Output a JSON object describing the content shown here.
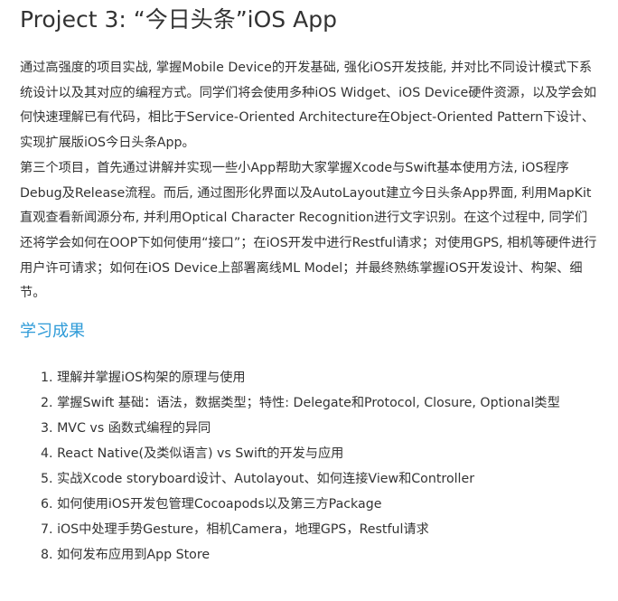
{
  "project": {
    "title": "Project 3: “今日头条”iOS App"
  },
  "description": {
    "paragraphs": [
      "通过高强度的项目实战, 掌握Mobile Device的开发基础, 强化iOS开发技能, 并对比不同设计模式下系统设计以及其对应的编程方式。同学们将会使用多种iOS Widget、iOS Device硬件资源，以及学会如何快速理解已有代码，相比于Service-Oriented Architecture在Object-Oriented Pattern下设计、实现扩展版iOS今日头条App。",
      "第三个项目，首先通过讲解并实现一些小App帮助大家掌握Xcode与Swift基本使用方法, iOS程序Debug及Release流程。而后, 通过图形化界面以及AutoLayout建立今日头条App界面, 利用MapKit直观查看新闻源分布, 并利用Optical Character Recognition进行文字识别。在这个过程中, 同学们还将学会如何在OOP下如何使用“接口”；在iOS开发中进行Restful请求；对使用GPS, 相机等硬件进行用户许可请求；如何在iOS Device上部署离线ML Model；并最终熟练掌握iOS开发设计、构架、细节。"
    ]
  },
  "outcomes": {
    "heading": "学习成果",
    "items": [
      {
        "number": "1.",
        "text": "理解并掌握iOS构架的原理与使用"
      },
      {
        "number": "2.",
        "text": "掌握Swift 基础：语法，数据类型；特性: Delegate和Protocol, Closure, Optional类型"
      },
      {
        "number": "3.",
        "text": "MVC vs 函数式编程的异同"
      },
      {
        "number": "4.",
        "text": "React Native(及类似语言) vs Swift的开发与应用"
      },
      {
        "number": "5.",
        "text": "实战Xcode storyboard设计、Autolayout、如何连接View和Controller"
      },
      {
        "number": "6.",
        "text": "如何使用iOS开发包管理Cocoapods以及第三方Package"
      },
      {
        "number": "7.",
        "text": "iOS中处理手势Gesture，相机Camera，地理GPS，Restful请求"
      },
      {
        "number": "8.",
        "text": "如何发布应用到App Store"
      }
    ]
  },
  "colors": {
    "text": "#333333",
    "accent_heading": "#2f9bd8",
    "background": "#ffffff"
  }
}
